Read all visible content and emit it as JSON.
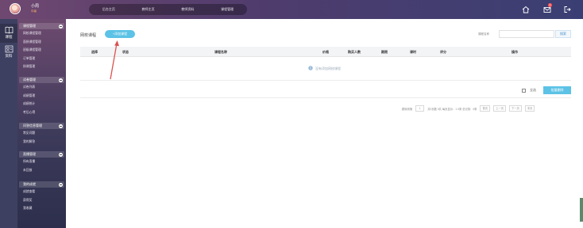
{
  "header": {
    "user": {
      "name": "小周",
      "level": "中级"
    },
    "nav": [
      "后台主页",
      "教师主页",
      "教师资料",
      "课程管理"
    ],
    "notification_count": "1"
  },
  "rail": [
    {
      "label": "课程",
      "icon": "book-icon",
      "active": true
    },
    {
      "label": "资料",
      "icon": "profile-card-icon",
      "active": false
    }
  ],
  "menu": [
    {
      "title": "课程管理",
      "items": [
        "网校课程管理",
        "面授课程管理",
        "班级课程管理",
        "订单管理",
        "授课管理"
      ]
    },
    {
      "title": "试卷管理",
      "items": [
        "试卷列表",
        "成绩管理",
        "成绩统计",
        "考后心得"
      ]
    },
    {
      "title": "问答信息管理",
      "items": [
        "常见问题",
        "我的解答"
      ]
    },
    {
      "title": "直播管理",
      "items": [
        "所有直播",
        "未回放"
      ]
    },
    {
      "title": "我的成就",
      "items": [
        "成就查看",
        "获得奖",
        "我收藏"
      ]
    }
  ],
  "main": {
    "page_title": "网校课程",
    "add_button": "+添加课程",
    "search_label": "课程名称",
    "search_placeholder": "",
    "search_button": "搜索",
    "columns": [
      "选择",
      "状态",
      "课程名称",
      "价格",
      "购买人数",
      "期限",
      "课时",
      "评分",
      "操作"
    ],
    "empty_message": "没有添加网校课程",
    "select_all": "全选",
    "batch_delete": "批量删除",
    "pagination": {
      "jump_to": "跳转到第",
      "page_input": "1",
      "summary": "共0页数 0共 每页显示：1 0条 总记录：0条",
      "first": "首页",
      "prev": "上一页",
      "next": "下一页",
      "last": "末页"
    }
  },
  "colors": {
    "accent": "#5cc2e6",
    "header_bg": "#4f3c6d",
    "annotation_arrow": "#d9534f"
  }
}
